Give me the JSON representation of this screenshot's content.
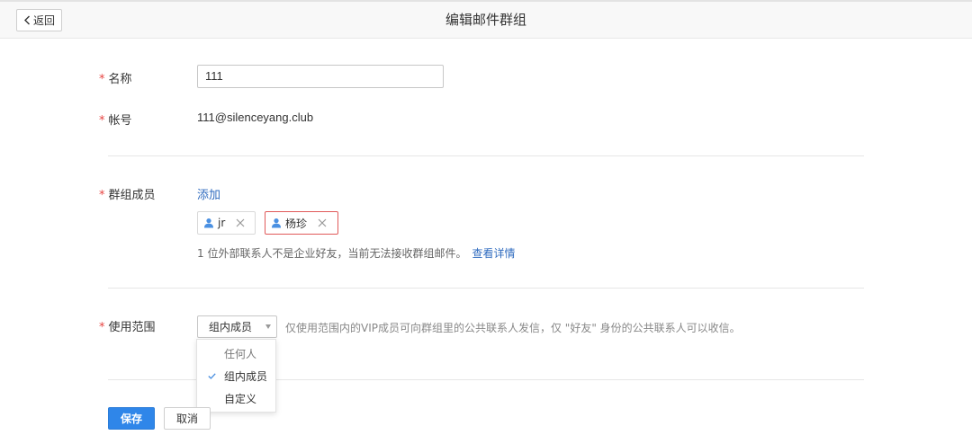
{
  "header": {
    "back_label": "返回",
    "title": "编辑邮件群组"
  },
  "form": {
    "required_mark": "*",
    "name": {
      "label": "名称",
      "value": "111"
    },
    "account": {
      "label": "帐号",
      "value": "111@silenceyang.club"
    },
    "members": {
      "label": "群组成员",
      "add_label": "添加",
      "list": [
        {
          "name": "jr",
          "external": false
        },
        {
          "name": "杨珍",
          "external": true
        }
      ],
      "notice": "1 位外部联系人不是企业好友，当前无法接收群组邮件。",
      "notice_link": "查看详情"
    },
    "scope": {
      "label": "使用范围",
      "selected": "组内成员",
      "hint": "仅使用范围内的VIP成员可向群组里的公共联系人发信，仅 \"好友\" 身份的公共联系人可以收信。",
      "options": [
        {
          "label": "任何人",
          "checked": false,
          "muted": true
        },
        {
          "label": "组内成员",
          "checked": true,
          "muted": false
        },
        {
          "label": "自定义",
          "checked": false,
          "muted": false
        }
      ]
    }
  },
  "actions": {
    "save_label": "保存",
    "cancel_label": "取消"
  },
  "colors": {
    "accent": "#2f86e9",
    "link": "#2f6bbf",
    "required": "#e64340",
    "warning_border": "#e05a5a"
  }
}
